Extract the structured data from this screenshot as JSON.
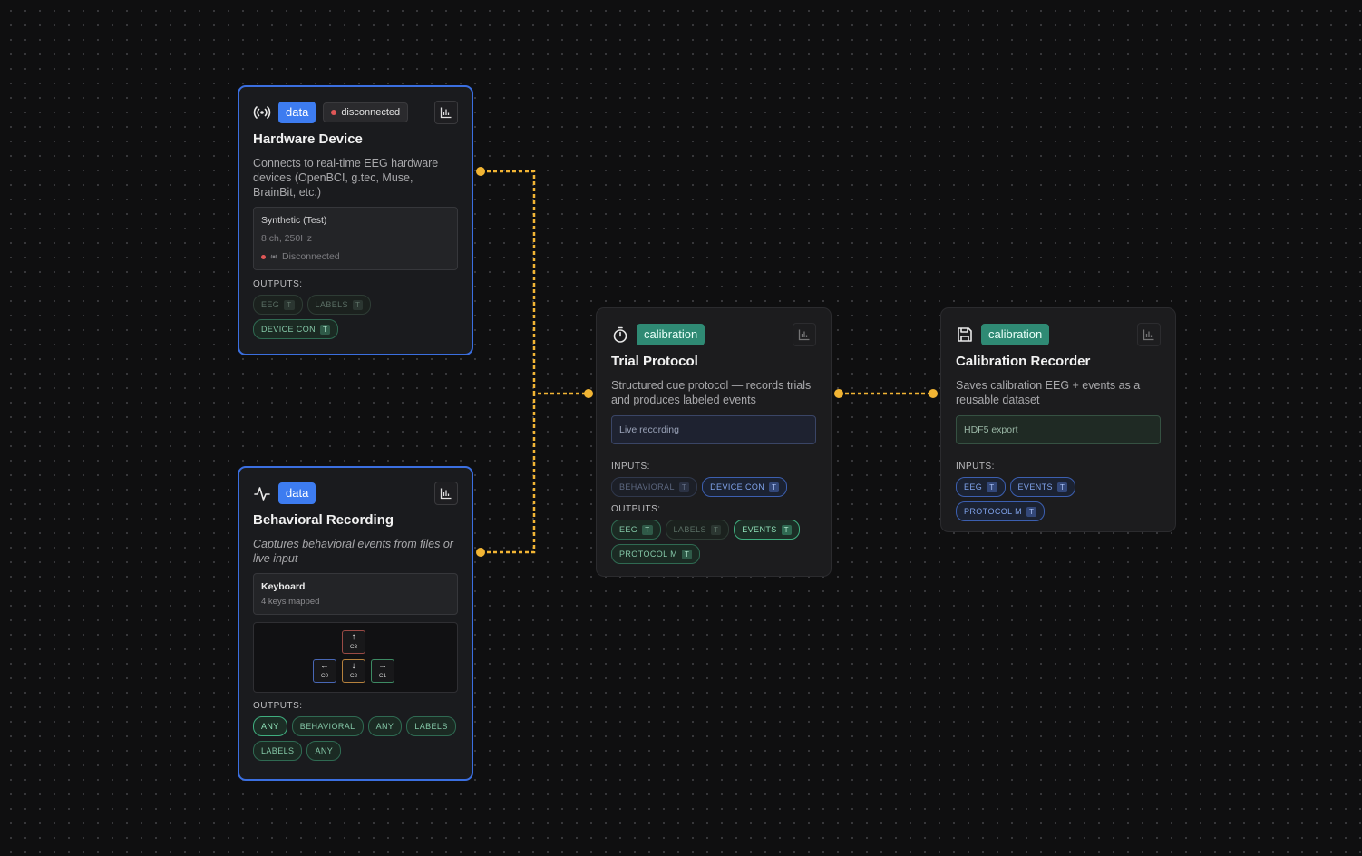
{
  "nodes": {
    "hardware": {
      "icon": "broadcast-icon",
      "category": "data",
      "status": "disconnected",
      "title": "Hardware Device",
      "description": "Connects to real-time EEG hardware devices (OpenBCI, g.tec, Muse, BrainBit, etc.)",
      "device": {
        "name": "Synthetic (Test)",
        "spec": "8 ch, 250Hz",
        "status": "Disconnected"
      },
      "outputs_label": "OUTPUTS:",
      "outputs": [
        {
          "label": "EEG",
          "tag": "T",
          "state": "dim"
        },
        {
          "label": "LABELS",
          "tag": "T",
          "state": "dim"
        },
        {
          "label": "DEVICE CON",
          "tag": "T",
          "state": "active"
        }
      ]
    },
    "behavioral": {
      "icon": "activity-icon",
      "category": "data",
      "title": "Behavioral Recording",
      "description": "Captures behavioral events from files or live input",
      "source": {
        "name": "Keyboard",
        "detail": "4 keys mapped"
      },
      "keys": [
        {
          "arrow": "↑",
          "code": "C3",
          "color": "red"
        },
        {
          "arrow": "←",
          "code": "C0",
          "color": "blue"
        },
        {
          "arrow": "↓",
          "code": "C2",
          "color": "orange"
        },
        {
          "arrow": "→",
          "code": "C1",
          "color": "green"
        }
      ],
      "outputs_label": "OUTPUTS:",
      "outputs": [
        {
          "label": "ANY",
          "state": "selected"
        },
        {
          "label": "BEHAVIORAL",
          "state": "active"
        },
        {
          "label": "ANY",
          "state": "active"
        },
        {
          "label": "LABELS",
          "state": "active"
        },
        {
          "label": "LABELS",
          "state": "active"
        },
        {
          "label": "ANY",
          "state": "active"
        }
      ]
    },
    "trial": {
      "icon": "timer-icon",
      "category": "calibration",
      "title": "Trial Protocol",
      "description": "Structured cue protocol — records trials and produces labeled events",
      "mode": "Live recording",
      "inputs_label": "INPUTS:",
      "inputs": [
        {
          "label": "BEHAVIORAL",
          "tag": "T",
          "state": "dim"
        },
        {
          "label": "DEVICE CON",
          "tag": "T",
          "state": "active"
        }
      ],
      "outputs_label": "OUTPUTS:",
      "outputs": [
        {
          "label": "EEG",
          "tag": "T",
          "state": "active"
        },
        {
          "label": "LABELS",
          "tag": "T",
          "state": "dim"
        },
        {
          "label": "EVENTS",
          "tag": "T",
          "state": "selected"
        },
        {
          "label": "PROTOCOL M",
          "tag": "T",
          "state": "active"
        }
      ]
    },
    "recorder": {
      "icon": "save-icon",
      "category": "calibration",
      "title": "Calibration Recorder",
      "description": "Saves calibration EEG + events as a reusable dataset",
      "format": "HDF5 export",
      "inputs_label": "INPUTS:",
      "inputs": [
        {
          "label": "EEG",
          "tag": "T",
          "state": "active"
        },
        {
          "label": "EVENTS",
          "tag": "T",
          "state": "active"
        },
        {
          "label": "PROTOCOL M",
          "tag": "T",
          "state": "active"
        }
      ]
    }
  },
  "colors": {
    "edge": "#f2b534",
    "data_badge": "#3d7cf0",
    "calibration_badge": "#2f8a74",
    "selected_border": "#3b6fe0",
    "status_dot": "#e05757"
  }
}
